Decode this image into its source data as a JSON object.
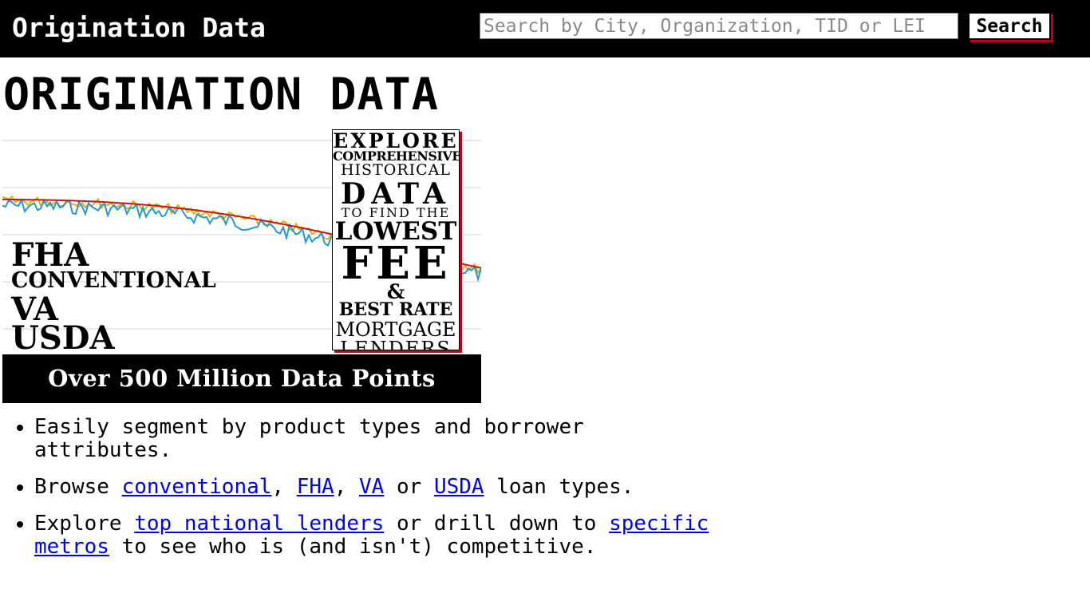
{
  "header": {
    "brand": "Origination Data",
    "search_placeholder": "Search by City, Organization, TID or LEI",
    "search_button": "Search"
  },
  "page_title": "ORIGINATION DATA",
  "hero": {
    "loan_types": [
      "FHA",
      "CONVENTIONAL",
      "VA",
      "USDA"
    ],
    "promo_lines": [
      "EXPLORE",
      "COMPREHENSIVE",
      "HISTORICAL",
      "DATA",
      "TO FIND THE",
      "LOWEST",
      "FEE",
      "&",
      "BEST RATE",
      "MORTGAGE",
      "LENDERS"
    ],
    "banner": "Over 500 Million Data Points",
    "series_colors": {
      "primary": "#1f9bd6",
      "secondary": "#e8b000",
      "trend": "#c2181e"
    }
  },
  "features": {
    "item1": "Easily segment by product types and borrower attributes.",
    "item2_prefix": "Browse ",
    "item2_link_conventional": "conventional",
    "item2_sep1": ", ",
    "item2_link_fha": "FHA",
    "item2_sep2": ", ",
    "item2_link_va": "VA",
    "item2_mid": " or ",
    "item2_link_usda": "USDA",
    "item2_suffix": " loan types.",
    "item3_prefix": "Explore ",
    "item3_link_lenders": "top national lenders",
    "item3_mid": " or drill down to ",
    "item3_link_metros": "specific metros",
    "item3_suffix": " to see who is (and isn't) competitive."
  }
}
